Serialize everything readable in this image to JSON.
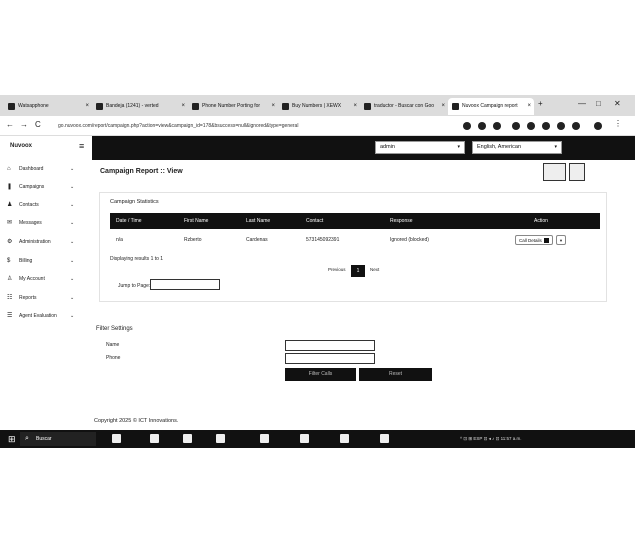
{
  "browser": {
    "tabs": [
      {
        "label": "Watsapphone",
        "close": "×"
      },
      {
        "label": "Bandeja (1241) - verted",
        "close": "×"
      },
      {
        "label": "Phone Number Porting for",
        "close": "×"
      },
      {
        "label": "Buy Numbers | XEWX",
        "close": "×"
      },
      {
        "label": "traductor - Buscar con Goo",
        "close": "×"
      },
      {
        "label": "Nuvoox Campaign report",
        "close": "×"
      }
    ],
    "new_tab": "+",
    "window_controls": {
      "minimize": "—",
      "maximize": "□",
      "close": "✕"
    },
    "nav": {
      "back": "←",
      "forward": "→",
      "reload": "C"
    },
    "url": "go.nuvoox.com/report/campaign.php?action=view&campaign_id=178&bsuccess=null&ignored&type=general"
  },
  "app": {
    "brand": "Nuvoox",
    "menu_toggle": "≡",
    "user_select": {
      "value": "admin",
      "caret": "▾"
    },
    "language_select": {
      "value": "English, American",
      "caret": "▾"
    }
  },
  "sidebar": {
    "items": [
      {
        "icon": "⌂",
        "label": "Dashboard",
        "chevron": "⌄"
      },
      {
        "icon": "❚",
        "label": "Campaigns",
        "chevron": "⌄"
      },
      {
        "icon": "♟",
        "label": "Contacts",
        "chevron": "⌄"
      },
      {
        "icon": "✉",
        "label": "Messages",
        "chevron": "⌄"
      },
      {
        "icon": "⚙",
        "label": "Administration",
        "chevron": "⌄"
      },
      {
        "icon": "$",
        "label": "Billing",
        "chevron": "⌄"
      },
      {
        "icon": "♙",
        "label": "My Account",
        "chevron": "⌄"
      },
      {
        "icon": "☷",
        "label": "Reports",
        "chevron": "⌄"
      },
      {
        "icon": "☰",
        "label": "Agent Evaluation",
        "chevron": "⌄"
      }
    ]
  },
  "page": {
    "title": "Campaign Report :: View",
    "logo_buttons": [
      "logo",
      "logo"
    ]
  },
  "stats": {
    "title": "Campaign Statistics",
    "columns": [
      "Date / Time",
      "First Name",
      "Last Name",
      "Contact",
      "Response",
      "Action"
    ],
    "rows": [
      {
        "date": "n/a",
        "first": "Rzberto",
        "last": "Cardenas",
        "contact": "573145092391",
        "response": "Ignored (blocked)",
        "action": "Call Details"
      }
    ],
    "action_caret": "▾",
    "results_text": "Displaying results 1 to 1",
    "pagination": {
      "prev": "Previous",
      "page": "1",
      "next": "Next"
    },
    "jump_label": "Jump to Page:"
  },
  "filter": {
    "title": "Filter Settings",
    "name_label": "Name",
    "phone_label": "Phone",
    "filter_button": "Filter Calls",
    "reset_button": "Reset"
  },
  "footer": {
    "copyright": "Copyright 2025 © ICT Innovations."
  },
  "taskbar": {
    "start": "⊞",
    "search_icon": "⌕",
    "search_placeholder": "Buscar",
    "tray": "^ ⊡ ⊞ ESP ⊡ ◂ ♪ ⊡ 11:57 a.m."
  }
}
